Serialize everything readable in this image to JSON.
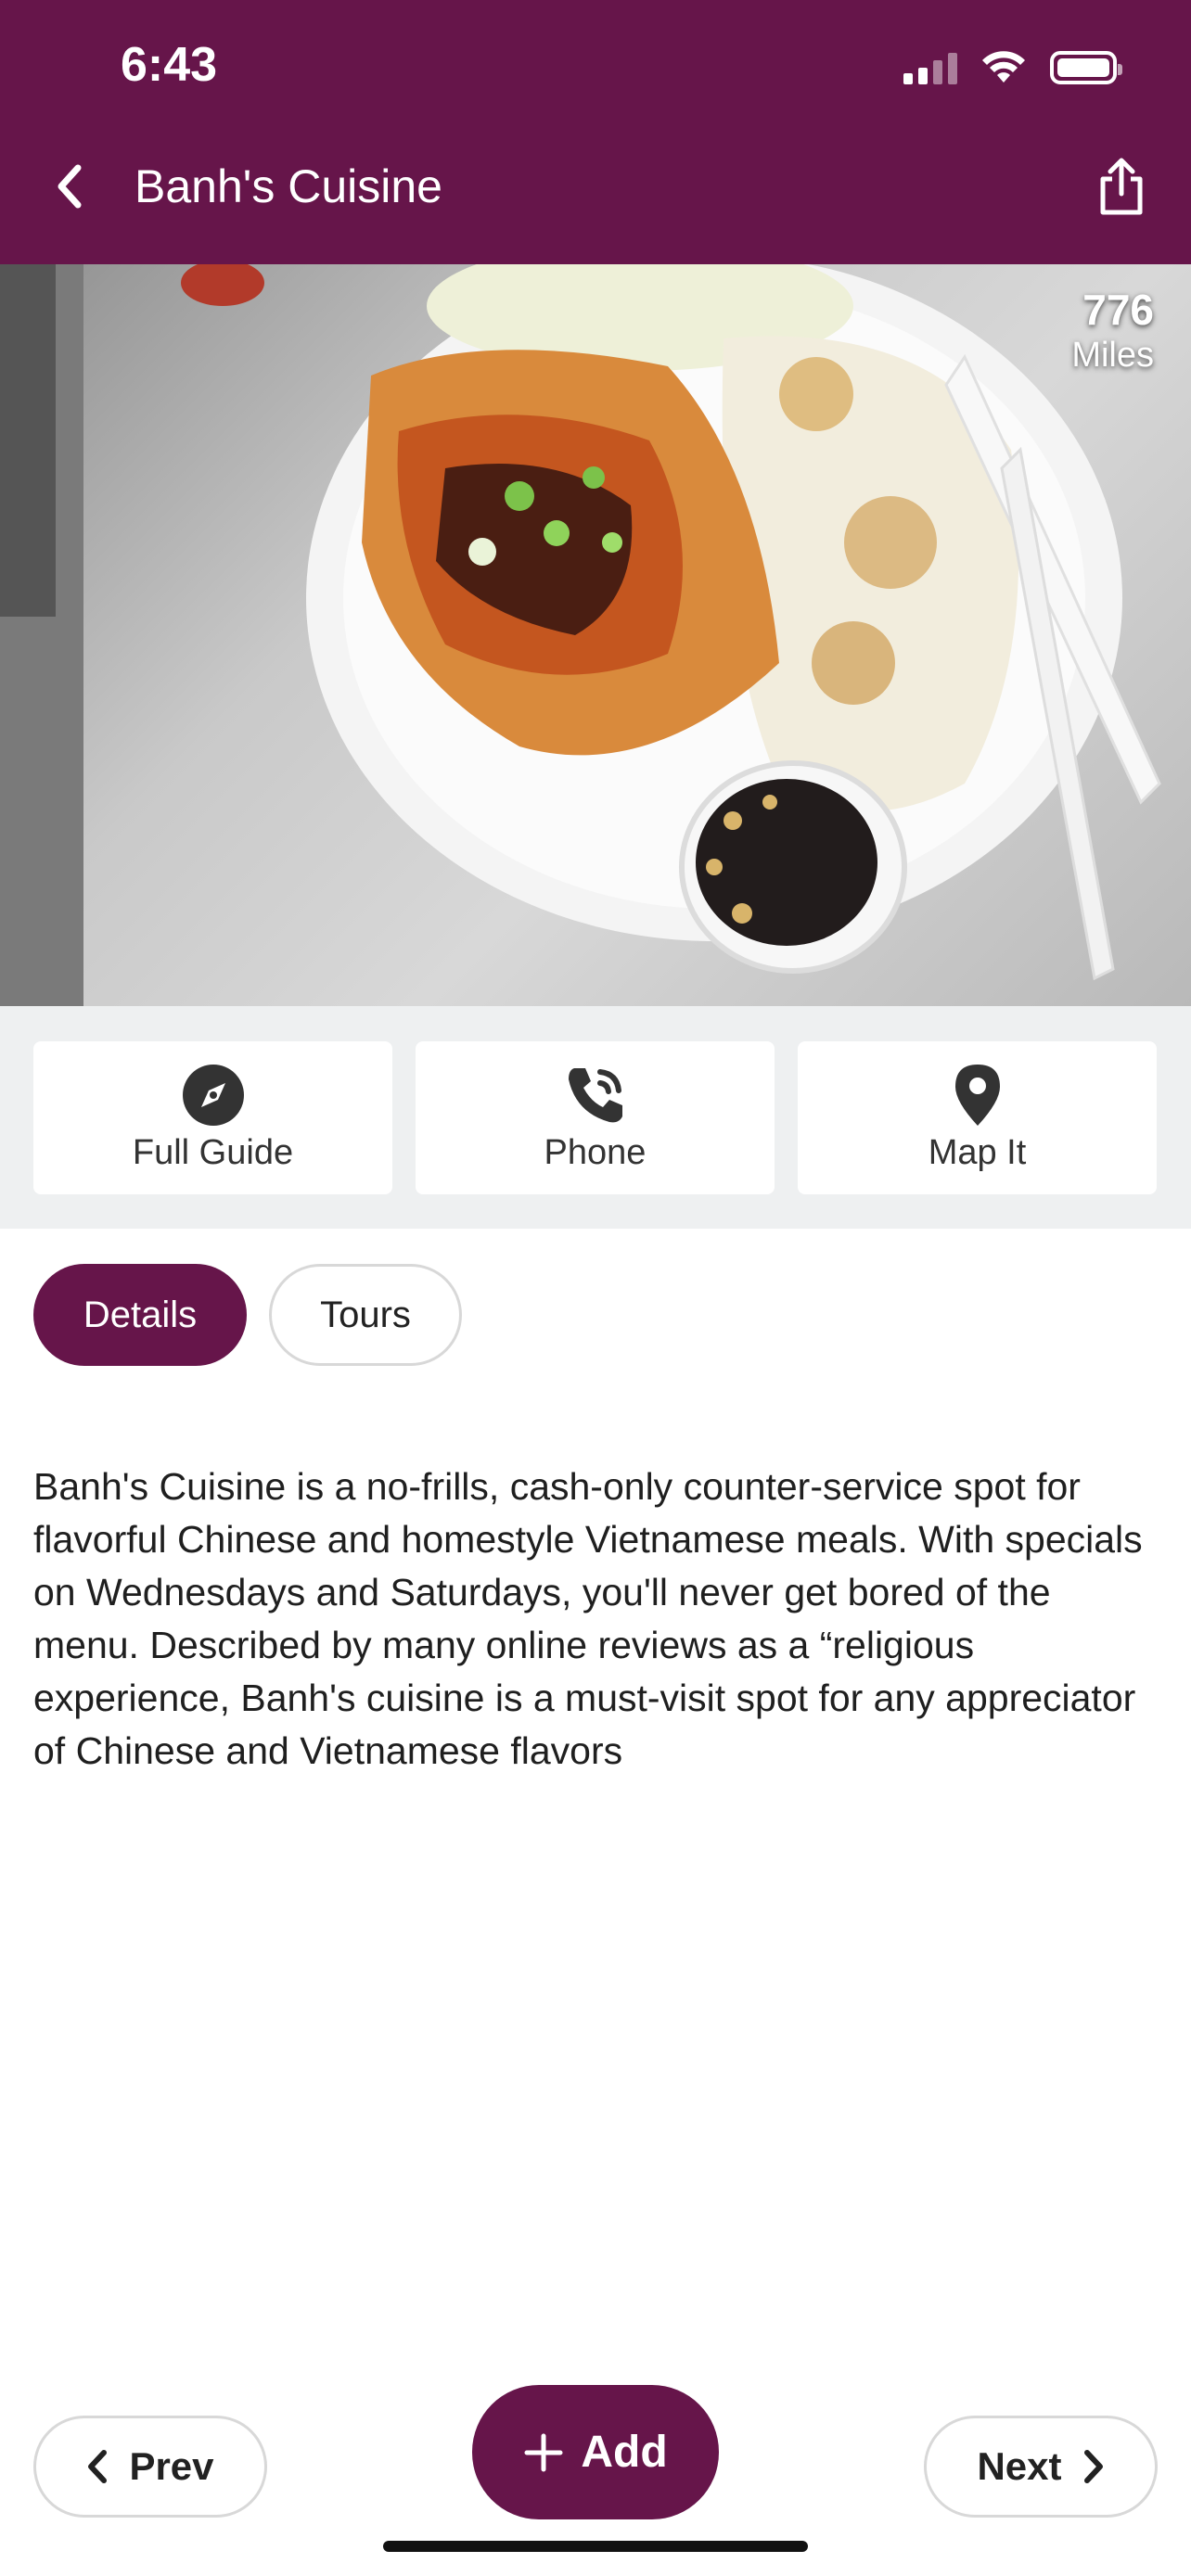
{
  "status_bar": {
    "time": "6:43"
  },
  "header": {
    "title": "Banh's Cuisine"
  },
  "hero": {
    "distance_value": "776",
    "distance_unit": "Miles"
  },
  "actions": [
    {
      "label": "Full Guide",
      "icon": "compass-icon"
    },
    {
      "label": "Phone",
      "icon": "phone-icon"
    },
    {
      "label": "Map It",
      "icon": "map-pin-icon"
    }
  ],
  "tabs": [
    {
      "label": "Details",
      "active": true
    },
    {
      "label": "Tours",
      "active": false
    }
  ],
  "description": "Banh's Cuisine is a no-frills, cash-only counter-service spot for flavorful Chinese and homestyle Vietnamese meals. With specials on Wednesdays and Saturdays, you'll never get bored of the menu. Described by many online reviews as a “religious experience, Banh's cuisine is a must-visit spot for any appreciator of Chinese and Vietnamese flavors",
  "footer": {
    "prev_label": "Prev",
    "add_label": "Add",
    "next_label": "Next"
  },
  "colors": {
    "brand": "#66154a",
    "action_bar_bg": "#eef0f1"
  }
}
